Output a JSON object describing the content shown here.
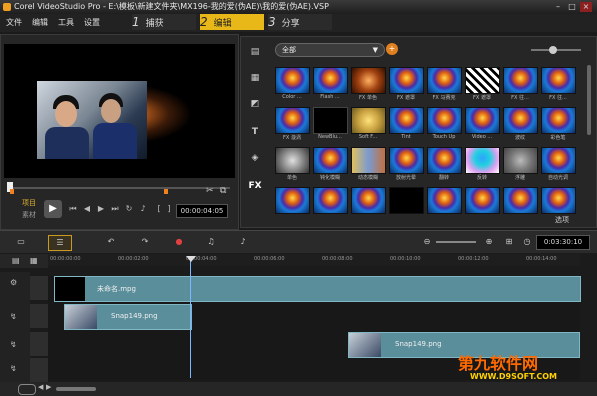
{
  "window": {
    "title": "Corel VideoStudio Pro - E:\\模板\\新建文件夹\\MX196-我的爱(伪AE)\\我的爱(伪AE).VSP",
    "min": "–",
    "max": "□",
    "close": "×"
  },
  "menu": [
    "文件",
    "编辑",
    "工具",
    "设置"
  ],
  "steps": [
    {
      "num": "1",
      "label": "捕获"
    },
    {
      "num": "2",
      "label": "编辑"
    },
    {
      "num": "3",
      "label": "分享"
    }
  ],
  "preview": {
    "project_label": "项目",
    "clip_label": "素材",
    "timecode": "00:00:04:05"
  },
  "library": {
    "category": "全部",
    "expand_label": "选项",
    "sidebar_icons": [
      "media-icon",
      "instant-project-icon",
      "transition-icon",
      "title-icon",
      "graphic-icon",
      "filter-icon"
    ],
    "fx_label": "FX",
    "t_label": "T",
    "thumbs": [
      "Color ...",
      "Flash ...",
      "FX 单色",
      "FX 遮罩",
      "FX 马赛克",
      "FX 遮罩",
      "FX 往...",
      "FX 往...",
      "FX 漩涡",
      "NewBlu...",
      "Soft F...",
      "Tint",
      "Touch Up",
      "Video ...",
      "波纹",
      "彩色笔",
      "单色",
      "钝化模糊",
      "动态模糊",
      "放射光晕",
      "翻转",
      "反转",
      "浮雕",
      "自动光调",
      "",
      "",
      "",
      "",
      "",
      "",
      "",
      ""
    ]
  },
  "timeline": {
    "timecode": "0:03:30:10",
    "ruler": [
      "00:00:00:00",
      "00:00:02:00",
      "00:00:04:00",
      "00:00:06:00",
      "00:00:08:00",
      "00:00:10:00",
      "00:00:12:00",
      "00:00:14:00"
    ],
    "clips": [
      {
        "name": "未命名.mpg"
      },
      {
        "name": "Snap149.png"
      },
      {
        "name": "Snap149.png"
      }
    ]
  },
  "watermark": {
    "main": "第九软件网",
    "sub": "WWW.D9SOFT.COM"
  }
}
